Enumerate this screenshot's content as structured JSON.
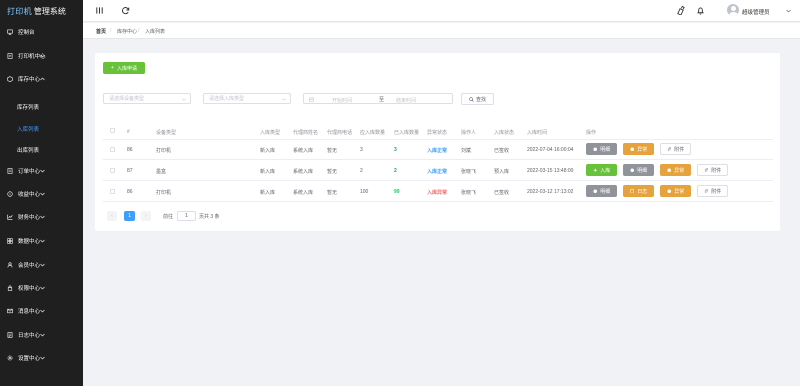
{
  "app": {
    "brand": "打印机",
    "title": "管理系统"
  },
  "sidebar": {
    "items": [
      {
        "label": "控制台",
        "icon": "monitor-icon"
      },
      {
        "label": "打印机中心",
        "icon": "printer-icon"
      },
      {
        "label": "库存中心",
        "icon": "box-icon",
        "expanded": true,
        "children": [
          {
            "label": "库存列表"
          },
          {
            "label": "入库列表",
            "active": true
          },
          {
            "label": "出库列表"
          }
        ]
      },
      {
        "label": "订单中心",
        "icon": "order-icon"
      },
      {
        "label": "收益中心",
        "icon": "coin-icon"
      },
      {
        "label": "财务中心",
        "icon": "chart-icon"
      },
      {
        "label": "数据中心",
        "icon": "data-icon"
      },
      {
        "label": "会员中心",
        "icon": "user-icon"
      },
      {
        "label": "权限中心",
        "icon": "lock-icon"
      },
      {
        "label": "消息中心",
        "icon": "message-icon"
      },
      {
        "label": "日志中心",
        "icon": "log-icon"
      },
      {
        "label": "设置中心",
        "icon": "gear-icon"
      }
    ]
  },
  "header": {
    "username": "超级管理员"
  },
  "breadcrumb": {
    "items": [
      "首页",
      "库存中心",
      "入库列表"
    ]
  },
  "toolbar": {
    "add_label": "入库申请"
  },
  "filters": {
    "device_type_placeholder": "请选择设备类型",
    "stock_type_placeholder": "请选择入库类型",
    "date_start_placeholder": "开始时间",
    "date_end_placeholder": "结束时间",
    "date_separator": "至",
    "search_label": "查找"
  },
  "table": {
    "headers": [
      "#",
      "设备类型",
      "入库类型",
      "代理商姓名",
      "代理商电话",
      "应入库数量",
      "已入库数量",
      "异常状态",
      "操作人",
      "入库状态",
      "入库时间",
      "操作"
    ],
    "rows": [
      {
        "id": "86",
        "device": "打印机",
        "type": "新入库",
        "agent": "系统入库",
        "phone": "暂无",
        "expected": "3",
        "received": "3",
        "status": "入库正常",
        "operator": "刘斌",
        "state": "已签收",
        "time": "2022-07-04 16:00:04",
        "actions": [
          "明细",
          "异常",
          "附件"
        ]
      },
      {
        "id": "87",
        "device": "墨盒",
        "type": "新入库",
        "agent": "系统入库",
        "phone": "暂无",
        "expected": "2",
        "received": "2",
        "status": "入库正常",
        "operator": "张晓飞",
        "state": "预入库",
        "time": "2022-03-15 13:48:00",
        "actions": [
          "入库",
          "明细",
          "异常",
          "附件"
        ]
      },
      {
        "id": "86",
        "device": "打印机",
        "type": "新入库",
        "agent": "系统入库",
        "phone": "暂无",
        "expected": "100",
        "received": "99",
        "status": "入库异常",
        "operator": "张晓飞",
        "state": "已签收",
        "time": "2022-03-12 17:13:02",
        "actions": [
          "明细",
          "日志",
          "异常",
          "附件"
        ]
      }
    ]
  },
  "pagination": {
    "current": "1",
    "goto_label": "前往",
    "goto_value": "1",
    "summary": "页共 3 条"
  },
  "colors": {
    "primary": "#409eff",
    "success": "#67c23a",
    "warning": "#e6a23c",
    "danger": "#f56c6c",
    "sidebar": "#1f1f1f"
  }
}
